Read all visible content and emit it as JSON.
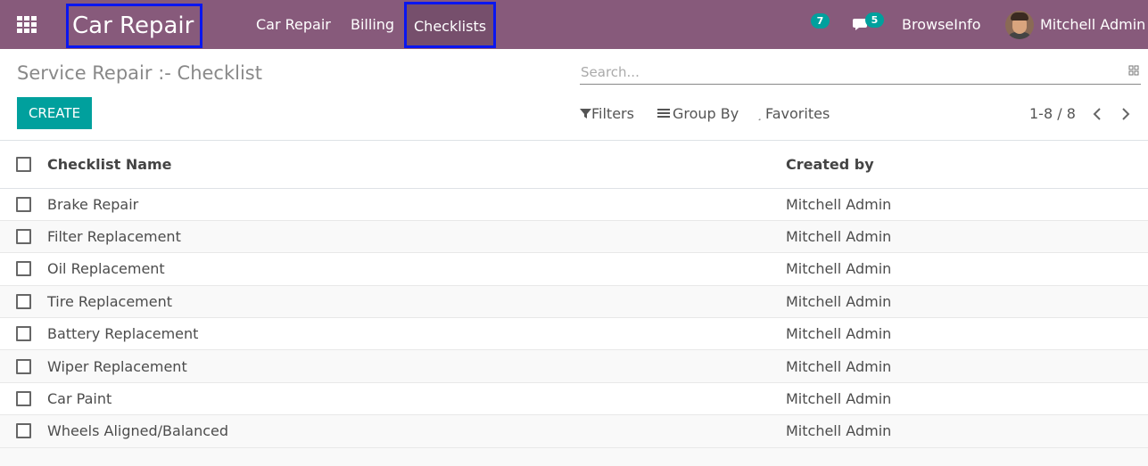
{
  "navbar": {
    "app_title": "Car Repair",
    "menus": [
      {
        "label": "Car Repair"
      },
      {
        "label": "Billing"
      },
      {
        "label": "Checklists",
        "active": true
      }
    ],
    "activity_count": "7",
    "message_count": "5",
    "company": "BrowseInfo",
    "user": "Mitchell Admin",
    "bg_color": "#875a7b",
    "badge_color": "#00a09d"
  },
  "control": {
    "breadcrumb": "Service Repair :- Checklist",
    "create_label": "CREATE",
    "search_placeholder": "Search...",
    "filters_label": "Filters",
    "groupby_label": "Group By",
    "favorites_label": "Favorites",
    "pager": "1-8 / 8"
  },
  "table": {
    "columns": [
      "Checklist Name",
      "Created by"
    ],
    "rows": [
      {
        "name": "Brake Repair",
        "created_by": "Mitchell Admin"
      },
      {
        "name": "Filter Replacement",
        "created_by": "Mitchell Admin"
      },
      {
        "name": "Oil Replacement",
        "created_by": "Mitchell Admin"
      },
      {
        "name": "Tire Replacement",
        "created_by": "Mitchell Admin"
      },
      {
        "name": "Battery Replacement",
        "created_by": "Mitchell Admin"
      },
      {
        "name": "Wiper Replacement",
        "created_by": "Mitchell Admin"
      },
      {
        "name": "Car Paint",
        "created_by": "Mitchell Admin"
      },
      {
        "name": "Wheels Aligned/Balanced",
        "created_by": "Mitchell Admin"
      }
    ]
  }
}
